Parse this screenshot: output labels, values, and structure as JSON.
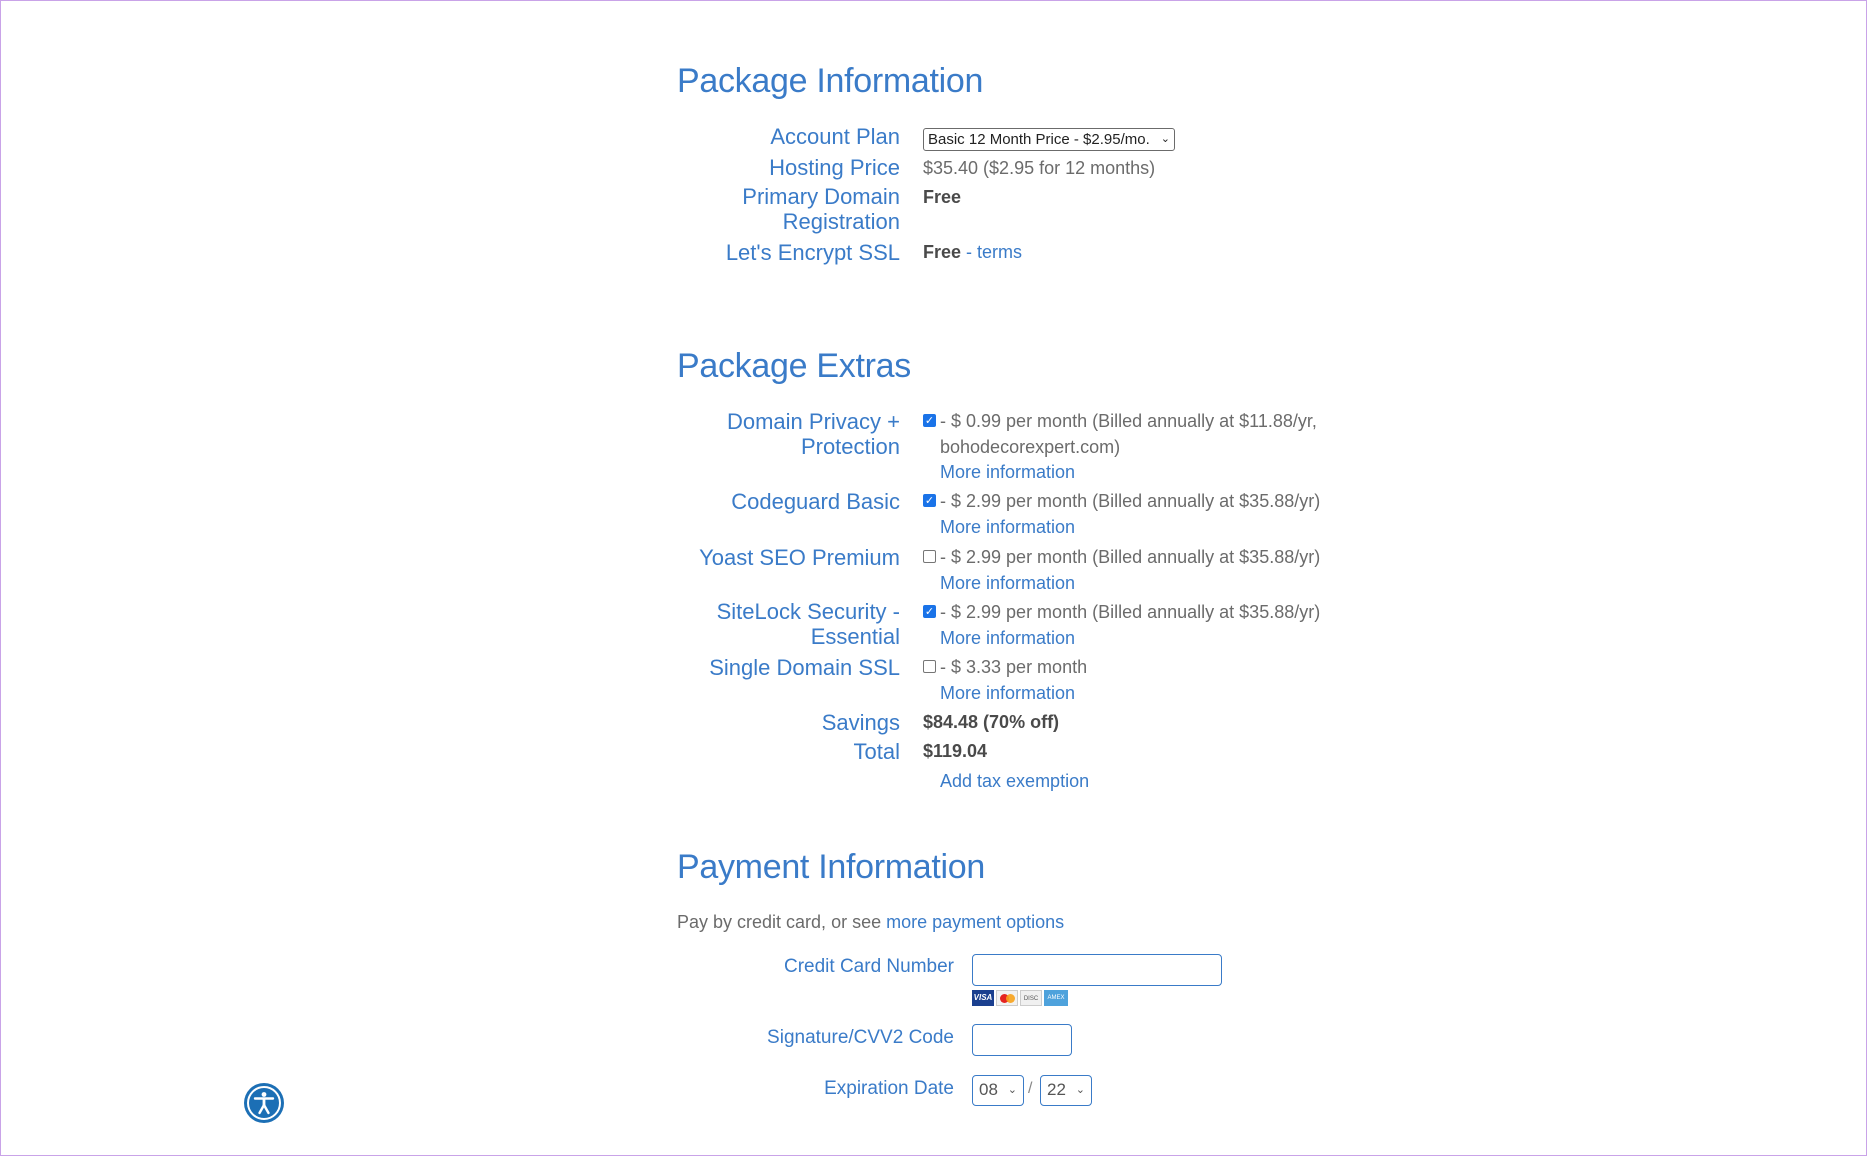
{
  "package_info": {
    "heading": "Package Information",
    "account_plan": {
      "label": "Account Plan",
      "selected": "Basic 12 Month Price - $2.95/mo."
    },
    "hosting_price": {
      "label": "Hosting Price",
      "value": "$35.40  ($2.95 for 12 months)"
    },
    "primary_domain": {
      "label_1": "Primary Domain",
      "label_2": "Registration",
      "value": "Free"
    },
    "ssl": {
      "label": "Let's Encrypt SSL",
      "value": "Free",
      "sep": " - ",
      "link": "terms"
    }
  },
  "package_extras": {
    "heading": "Package Extras",
    "items": [
      {
        "label_1": "Domain Privacy +",
        "label_2": "Protection",
        "checked": true,
        "desc_1": "- $ 0.99 per month (Billed annually at $11.88/yr,",
        "desc_2": "bohodecorexpert.com)",
        "link": "More information"
      },
      {
        "label_1": "Codeguard Basic",
        "checked": true,
        "desc_1": "- $ 2.99 per month (Billed annually at $35.88/yr)",
        "link": "More information"
      },
      {
        "label_1": "Yoast SEO Premium",
        "checked": false,
        "desc_1": "- $ 2.99 per month (Billed annually at $35.88/yr)",
        "link": "More information"
      },
      {
        "label_1": "SiteLock Security -",
        "label_2": "Essential",
        "checked": true,
        "desc_1": "- $ 2.99 per month (Billed annually at $35.88/yr)",
        "link": "More information"
      },
      {
        "label_1": "Single Domain SSL",
        "checked": false,
        "desc_1": "- $ 3.33 per month",
        "link": "More information"
      }
    ],
    "savings": {
      "label": "Savings",
      "value": "$84.48 (70% off)"
    },
    "total": {
      "label": "Total",
      "value": "$119.04"
    },
    "tax_link": "Add tax exemption"
  },
  "payment": {
    "heading": "Payment Information",
    "intro": "Pay by credit card, or see ",
    "intro_link": "more payment options",
    "card_label": "Credit Card Number",
    "card_value": "",
    "card_brands": [
      "VISA",
      "MC",
      "DISC",
      "AMEX"
    ],
    "cvv_label": "Signature/CVV2 Code",
    "cvv_value": "",
    "exp_label": "Expiration Date",
    "exp_month": "08",
    "exp_sep": "/",
    "exp_year": "22"
  },
  "colors": {
    "accent": "#3a7bc8",
    "frame": "#c9a3e8",
    "checkbox": "#1a73e8",
    "a11y": "#1c6fb5"
  },
  "icons": {
    "accessibility": "accessibility-icon"
  }
}
